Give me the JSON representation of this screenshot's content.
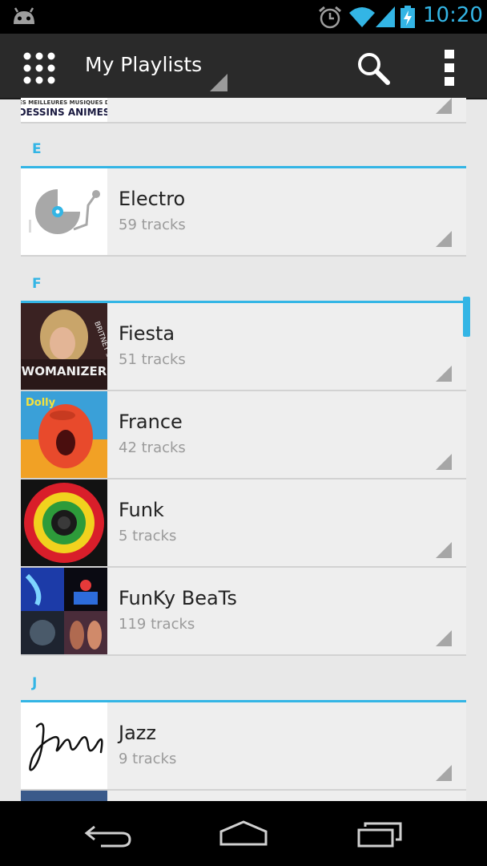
{
  "status_bar": {
    "time": "10:20"
  },
  "action_bar": {
    "title": "My Playlists"
  },
  "sections": [
    {
      "letter": "E"
    },
    {
      "letter": "F"
    },
    {
      "letter": "J"
    }
  ],
  "partial_top_item": {
    "art_line1": "LES MEILLEURES MUSIQUES DE",
    "art_line2": "DESSINS ANIMES"
  },
  "playlists": [
    {
      "name": "Electro",
      "tracks": "59 tracks",
      "art": "turntable"
    },
    {
      "name": "Fiesta",
      "tracks": "51 tracks",
      "art": "womanizer",
      "art_text": "WOMANIZER",
      "art_text2": "BRITNEY SPEARS"
    },
    {
      "name": "France",
      "tracks": "42 tracks",
      "art": "dolly",
      "art_text": "Dolly"
    },
    {
      "name": "Funk",
      "tracks": "5 tracks",
      "art": "circles"
    },
    {
      "name": "FunKy BeaTs",
      "tracks": "119 tracks",
      "art": "collage"
    },
    {
      "name": "Jazz",
      "tracks": "9 tracks",
      "art": "jazz-script"
    }
  ],
  "colors": {
    "accent": "#33b5e5",
    "action_bar": "#2a2a2a",
    "list_bg": "#eeeeee"
  }
}
